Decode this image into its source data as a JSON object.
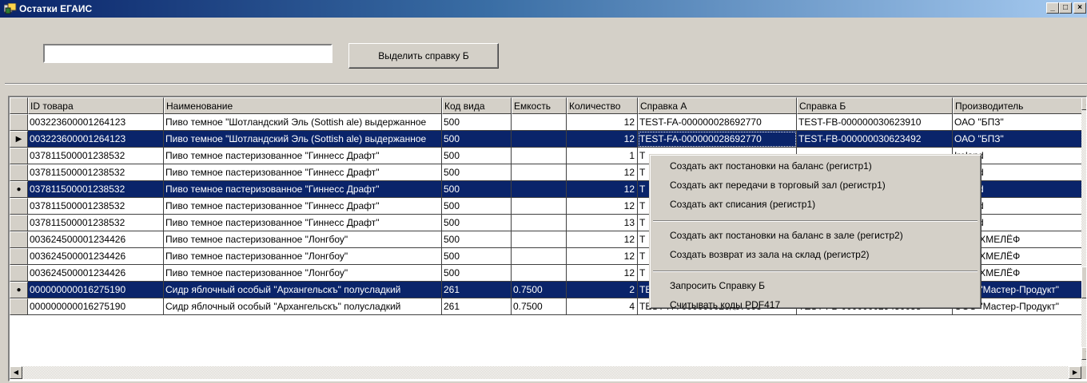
{
  "window": {
    "title": "Остатки ЕГАИС",
    "app_icon": "app-window-icon",
    "controls": {
      "minimize": "_",
      "maximize": "□",
      "close": "×"
    }
  },
  "toolbar": {
    "search_value": "",
    "button_label": "Выделить справку Б"
  },
  "grid": {
    "columns": [
      "ID товара",
      "Наименование",
      "Код вида",
      "Емкость",
      "Количество",
      "Справка А",
      "Справка Б",
      "Производитель"
    ],
    "rows": [
      {
        "indicator": "",
        "cells": [
          "003223600001264123",
          "Пиво темное \"Шотландский Эль (Sottish ale) выдержанное",
          "500",
          "",
          "12",
          "TEST-FA-000000028692770",
          "TEST-FB-000000030623910",
          "ОАО \"БПЗ\""
        ]
      },
      {
        "indicator": "▶",
        "cells": [
          "003223600001264123",
          "Пиво темное \"Шотландский Эль (Sottish ale) выдержанное",
          "500",
          "",
          "12",
          "TEST-FA-000000028692770",
          "TEST-FB-000000030623492",
          "ОАО \"БПЗ\""
        ]
      },
      {
        "indicator": "",
        "cells": [
          "037811500001238532",
          "Пиво темное пастеризованное \"Гиннесс Драфт\"",
          "500",
          "",
          "1",
          "T",
          "",
          "Ireland"
        ]
      },
      {
        "indicator": "",
        "cells": [
          "037811500001238532",
          "Пиво темное пастеризованное \"Гиннесс Драфт\"",
          "500",
          "",
          "12",
          "T",
          "",
          "Ireland"
        ]
      },
      {
        "indicator": "●",
        "cells": [
          "037811500001238532",
          "Пиво темное пастеризованное \"Гиннесс Драфт\"",
          "500",
          "",
          "12",
          "T",
          "",
          "Ireland"
        ]
      },
      {
        "indicator": "",
        "cells": [
          "037811500001238532",
          "Пиво темное пастеризованное \"Гиннесс Драфт\"",
          "500",
          "",
          "12",
          "T",
          "",
          "Ireland"
        ]
      },
      {
        "indicator": "",
        "cells": [
          "037811500001238532",
          "Пиво темное пастеризованное \"Гиннесс Драфт\"",
          "500",
          "",
          "13",
          "T",
          "",
          "Ireland"
        ]
      },
      {
        "indicator": "",
        "cells": [
          "003624500001234426",
          "Пиво темное пастеризованное \"Лонгбоу\"",
          "500",
          "",
          "12",
          "T",
          "",
          "РПК \"ХМЕЛЁФ"
        ]
      },
      {
        "indicator": "",
        "cells": [
          "003624500001234426",
          "Пиво темное пастеризованное \"Лонгбоу\"",
          "500",
          "",
          "12",
          "T",
          "",
          "РПК \"ХМЕЛЁФ"
        ]
      },
      {
        "indicator": "",
        "cells": [
          "003624500001234426",
          "Пиво темное пастеризованное \"Лонгбоу\"",
          "500",
          "",
          "12",
          "T",
          "",
          "РПК \"ХМЕЛЁФ"
        ]
      },
      {
        "indicator": "●",
        "cells": [
          "000000000016275190",
          "Сидр яблочный особый \"Архангельскъ\" полусладкий",
          "261",
          "0.7500",
          "2",
          "TEST-FA-000000026407603",
          "TEST-FB-000000030327055",
          "ООО \"Мастер-Продукт\""
        ]
      },
      {
        "indicator": "",
        "cells": [
          "000000000016275190",
          "Сидр яблочный особый \"Архангельскъ\" полусладкий",
          "261",
          "0.7500",
          "4",
          "TEST-FA-000000026407603",
          "TEST-FB-000000029450058",
          "ООО \"Мастер-Продукт\""
        ]
      }
    ]
  },
  "context_menu": {
    "groups": [
      [
        "Создать акт постановки на баланс (регистр1)",
        "Создать акт передачи в торговый зал (регистр1)",
        "Создать акт списания (регистр1)"
      ],
      [
        "Создать акт постановки на баланс в зале (регистр2)",
        "Создать возврат из зала на склад  (регистр2)"
      ],
      [
        "Запросить Справку Б",
        "Считывать коды PDF417"
      ]
    ]
  },
  "scrollbars": {
    "up": "▲",
    "down": "▼",
    "left": "◀",
    "right": "▶"
  }
}
